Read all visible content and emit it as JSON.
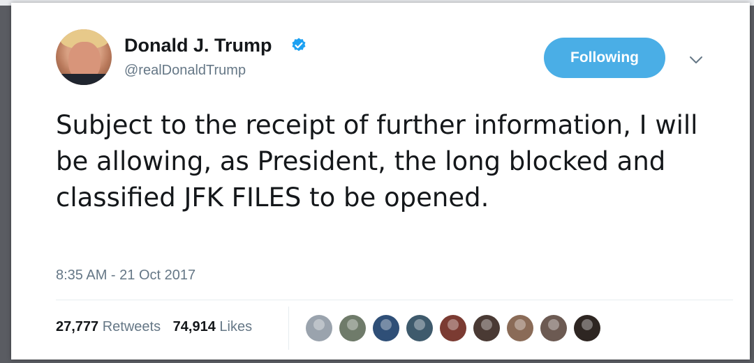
{
  "tweet": {
    "author": {
      "name": "Donald J. Trump",
      "handle": "@realDonaldTrump",
      "verified": true
    },
    "follow_button_label": "Following",
    "text": "Subject to the receipt of further information, I will be allowing, as President, the long blocked and classified JFK FILES to be opened.",
    "timestamp": "8:35 AM - 21 Oct 2017",
    "stats": {
      "retweets_count": "27,777",
      "retweets_label": "Retweets",
      "likes_count": "74,914",
      "likes_label": "Likes"
    },
    "liker_avatars": [
      {
        "icon": "default-avatar",
        "color": "#9aa3ad"
      },
      {
        "icon": "user-avatar",
        "color": "#6f7b6a"
      },
      {
        "icon": "user-avatar",
        "color": "#2f4f77"
      },
      {
        "icon": "user-avatar",
        "color": "#3e5a6c"
      },
      {
        "icon": "user-avatar",
        "color": "#7b3b32"
      },
      {
        "icon": "user-avatar",
        "color": "#4a3a34"
      },
      {
        "icon": "user-avatar",
        "color": "#8a6b57"
      },
      {
        "icon": "user-avatar",
        "color": "#6c5a52"
      },
      {
        "icon": "user-avatar",
        "color": "#2e2622"
      }
    ]
  },
  "colors": {
    "accent": "#4aaee6",
    "text_primary": "#14171a",
    "text_secondary": "#657786",
    "verified_badge": "#1da1f2"
  }
}
